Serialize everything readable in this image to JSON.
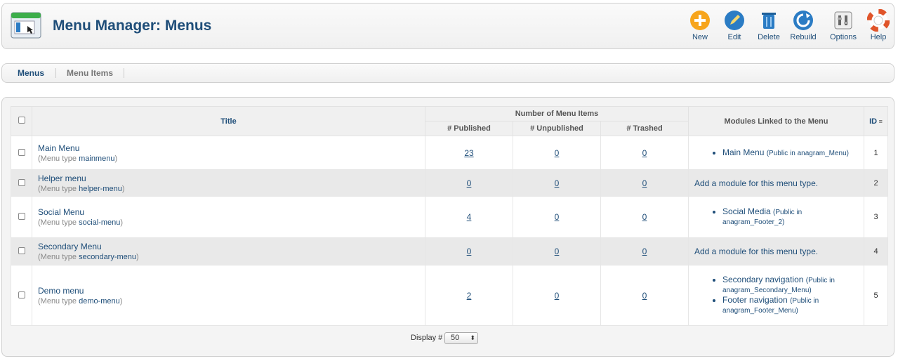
{
  "header": {
    "title": "Menu Manager: Menus"
  },
  "toolbar": {
    "buttons": [
      {
        "label": "New",
        "icon": "new-icon",
        "color": "#f7a51c"
      },
      {
        "label": "Edit",
        "icon": "edit-icon",
        "color": "#2b7cc4"
      },
      {
        "label": "Delete",
        "icon": "delete-icon",
        "color": "#2b7cc4"
      },
      {
        "label": "Rebuild",
        "icon": "rebuild-icon",
        "color": "#2b7cc4"
      },
      {
        "label": "Options",
        "icon": "options-icon",
        "color": "#888888"
      },
      {
        "label": "Help",
        "icon": "help-icon",
        "color": "#e0552b"
      }
    ]
  },
  "subnav": {
    "tabs": [
      {
        "label": "Menus",
        "active": true
      },
      {
        "label": "Menu Items",
        "active": false
      }
    ]
  },
  "table": {
    "headers": {
      "title": "Title",
      "group": "Number of Menu Items",
      "published": "# Published",
      "unpublished": "# Unpublished",
      "trashed": "# Trashed",
      "modules": "Modules Linked to the Menu",
      "id": "ID"
    },
    "menu_type_label": "(Menu type",
    "rows": [
      {
        "title": "Main Menu",
        "type": "mainmenu",
        "published": "23",
        "unpublished": "0",
        "trashed": "0",
        "modules": [
          {
            "name": "Main Menu",
            "pub": "(Public in anagram_Menu)"
          }
        ],
        "id": "1"
      },
      {
        "title": "Helper menu",
        "type": "helper-menu",
        "published": "0",
        "unpublished": "0",
        "trashed": "0",
        "add_module": "Add a module for this menu type.",
        "id": "2"
      },
      {
        "title": "Social Menu",
        "type": "social-menu",
        "published": "4",
        "unpublished": "0",
        "trashed": "0",
        "modules": [
          {
            "name": "Social Media",
            "pub": "(Public in anagram_Footer_2)"
          }
        ],
        "id": "3"
      },
      {
        "title": "Secondary Menu",
        "type": "secondary-menu",
        "published": "0",
        "unpublished": "0",
        "trashed": "0",
        "add_module": "Add a module for this menu type.",
        "id": "4"
      },
      {
        "title": "Demo menu",
        "type": "demo-menu",
        "published": "2",
        "unpublished": "0",
        "trashed": "0",
        "modules": [
          {
            "name": "Secondary navigation",
            "pub": "(Public in anagram_Secondary_Menu)"
          },
          {
            "name": "Footer navigation",
            "pub": "(Public in anagram_Footer_Menu)"
          }
        ],
        "id": "5"
      }
    ]
  },
  "footer": {
    "display_label": "Display #",
    "display_value": "50"
  }
}
